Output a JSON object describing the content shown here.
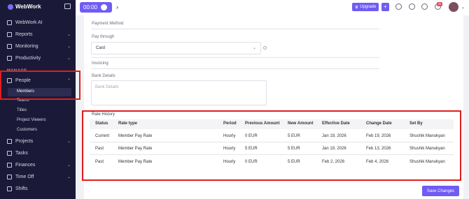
{
  "app": {
    "name": "WebWork"
  },
  "topbar": {
    "timer": "00:00",
    "upgrade_label": "Upgrade",
    "notification_count": "20"
  },
  "sidebar": {
    "items": [
      {
        "label": "WebWork AI"
      },
      {
        "label": "Reports"
      },
      {
        "label": "Monitoring"
      },
      {
        "label": "Productivity"
      }
    ],
    "section": "MANAGE",
    "people": "People",
    "members": "Members",
    "sub_items": [
      "Teams",
      "Titles",
      "Project Viewers",
      "Customers"
    ],
    "lower_items": [
      {
        "label": "Projects"
      },
      {
        "label": "Tasks"
      },
      {
        "label": "Finances"
      },
      {
        "label": "Time Off"
      },
      {
        "label": "Shifts"
      }
    ]
  },
  "form": {
    "payment_method_heading": "Payment Method",
    "pay_through_label": "Pay through",
    "pay_through_value": "Card",
    "invoicing_heading": "Invoicing",
    "bank_details_label": "Bank Details",
    "bank_details_placeholder": "Bank Details"
  },
  "rate_history": {
    "title": "Rate History",
    "columns": [
      "Status",
      "Rate type",
      "Period",
      "Previous Amount",
      "New Amount",
      "Effective Date",
      "Change Date",
      "Set By"
    ],
    "rows": [
      [
        "Current",
        "Member Pay Rate",
        "Hourly",
        "0 EUR",
        "5 EUR",
        "Jan 19, 2026",
        "Feb 19, 2026",
        "Shushik Manukyan"
      ],
      [
        "Past",
        "Member Pay Rate",
        "Hourly",
        "5 EUR",
        "5 EUR",
        "Jan 19, 2026",
        "Feb 13, 2026",
        "Shushik Manukyan"
      ],
      [
        "Past",
        "Member Pay Rate",
        "Hourly",
        "0 EUR",
        "5 EUR",
        "Feb 2, 2026",
        "Feb 4, 2026",
        "Shushik Manukyan"
      ]
    ]
  },
  "save_label": "Save Changes",
  "colors": {
    "accent": "#6f5cf3",
    "sidebar": "#1a1a38",
    "highlight": "#e01e1e"
  }
}
